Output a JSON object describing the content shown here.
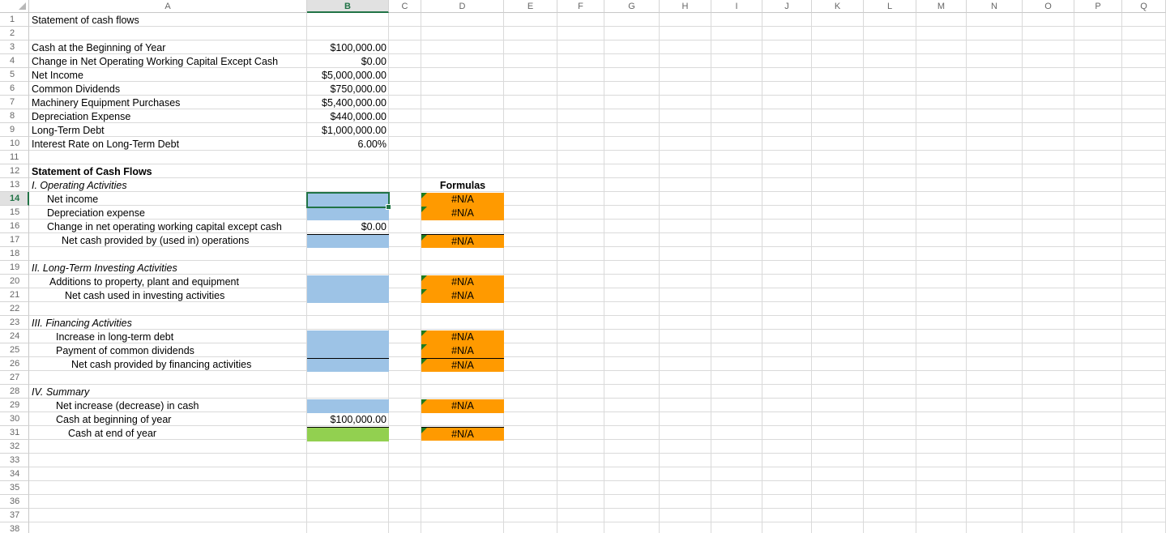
{
  "columns": [
    "A",
    "B",
    "C",
    "D",
    "E",
    "F",
    "G",
    "H",
    "I",
    "J",
    "K",
    "L",
    "M",
    "N",
    "O",
    "P",
    "Q"
  ],
  "rows": [
    "1",
    "2",
    "3",
    "4",
    "5",
    "6",
    "7",
    "8",
    "9",
    "10",
    "11",
    "12",
    "13",
    "14",
    "15",
    "16",
    "17",
    "18",
    "19",
    "20",
    "21",
    "22",
    "23",
    "24",
    "25",
    "26",
    "27",
    "28",
    "29",
    "30",
    "31",
    "32",
    "33",
    "34",
    "35",
    "36",
    "37",
    "38"
  ],
  "selected": {
    "column": "B",
    "row": "14"
  },
  "sheet": {
    "title": "Statement of cash flows",
    "inputs": [
      {
        "label": "Cash at the Beginning of Year",
        "value": "$100,000.00"
      },
      {
        "label": "Change in Net Operating Working Capital Except Cash",
        "value": "$0.00"
      },
      {
        "label": "Net Income",
        "value": "$5,000,000.00"
      },
      {
        "label": "Common Dividends",
        "value": "$750,000.00"
      },
      {
        "label": "Machinery Equipment Purchases",
        "value": "$5,400,000.00"
      },
      {
        "label": "Depreciation Expense",
        "value": "$440,000.00"
      },
      {
        "label": "Long-Term Debt",
        "value": "$1,000,000.00"
      },
      {
        "label": "Interest Rate on Long-Term Debt",
        "value": "6.00%"
      }
    ],
    "statement_title": "Statement of Cash Flows",
    "formulas_header": "Formulas",
    "operating": {
      "heading": "I.  Operating Activities",
      "net_income": "Net income",
      "depreciation": "Depreciation expense",
      "change_nowc": "Change in net operating working capital except cash",
      "change_nowc_value": "$0.00",
      "net_ops": "Net cash provided by (used in) operations"
    },
    "investing": {
      "heading": "II.  Long-Term Investing Activities",
      "additions": "Additions to property, plant and equipment",
      "net_investing": "Net cash used in investing activities"
    },
    "financing": {
      "heading": "III.  Financing Activities",
      "increase_debt": "Increase in long-term debt",
      "dividends": "Payment of common dividends",
      "net_financing": "Net cash provided by financing activities"
    },
    "summary": {
      "heading": "IV.  Summary",
      "net_increase": "Net increase (decrease) in cash",
      "cash_begin": "Cash at beginning of year",
      "cash_begin_value": "$100,000.00",
      "cash_end": "Cash at end of year"
    },
    "na": "#N/A"
  },
  "colors": {
    "input_fill": "#9dc3e6",
    "result_fill": "#92d050",
    "formula_fill": "#ff9a00",
    "selection": "#217346"
  }
}
